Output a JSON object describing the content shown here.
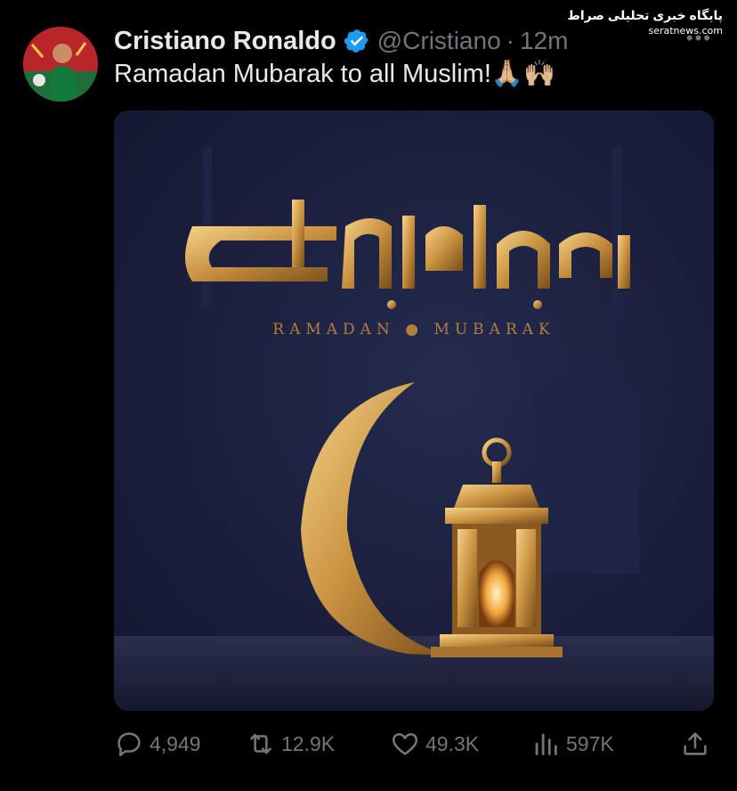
{
  "author": {
    "display_name": "Cristiano Ronaldo",
    "handle": "@Cristiano",
    "separator": "·",
    "time": "12m",
    "verified": true,
    "verified_color": "#1d9bf0"
  },
  "more_menu": "•••",
  "watermark": {
    "title": "پایگاه خبری تحلیلی صراط",
    "site": "serat‌news.com"
  },
  "tweet": {
    "text": "Ramadan Mubarak to all Muslim!🙏🏼🙌🏼"
  },
  "media": {
    "subtitle": "RAMADAN ● MUBARAK",
    "background_color": "#1a1f3c",
    "gold_color": "#c8913f"
  },
  "actions": {
    "reply": {
      "icon": "reply-icon",
      "count": "4,949"
    },
    "retweet": {
      "icon": "retweet-icon",
      "count": "12.9K"
    },
    "like": {
      "icon": "heart-icon",
      "count": "49.3K"
    },
    "views": {
      "icon": "views-icon",
      "count": "597K"
    },
    "share": {
      "icon": "share-icon"
    }
  }
}
